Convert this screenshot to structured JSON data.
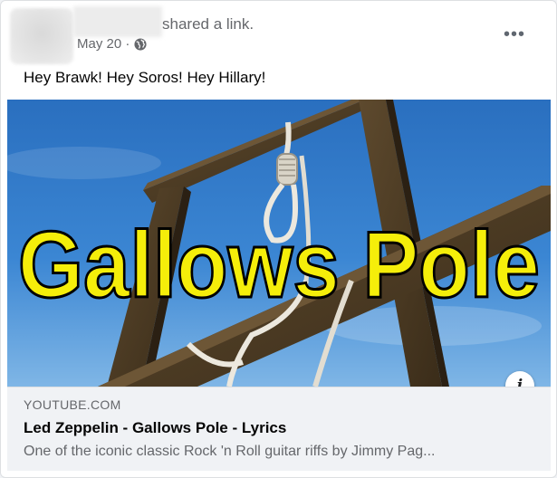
{
  "post": {
    "shared_text": "shared a link.",
    "date": "May 20 ·",
    "privacy_icon": "globe-icon",
    "more_icon": "more-options-icon",
    "more_label": "•••",
    "body_text": "Hey Brawk! Hey Soros! Hey Hillary!"
  },
  "preview": {
    "image_text": "Gallows Pole",
    "info_icon": "info-icon",
    "info_label": "i"
  },
  "link": {
    "domain": "YOUTUBE.COM",
    "title": "Led Zeppelin - Gallows Pole - Lyrics",
    "description": "One of the iconic classic Rock 'n Roll guitar riffs by Jimmy Pag..."
  },
  "colors": {
    "sky": "#2f78c4",
    "wood": "#4d3a23",
    "headline_fill": "#f5ee0a",
    "secondary_text": "#65676b",
    "link_bar_bg": "#f0f2f5"
  }
}
